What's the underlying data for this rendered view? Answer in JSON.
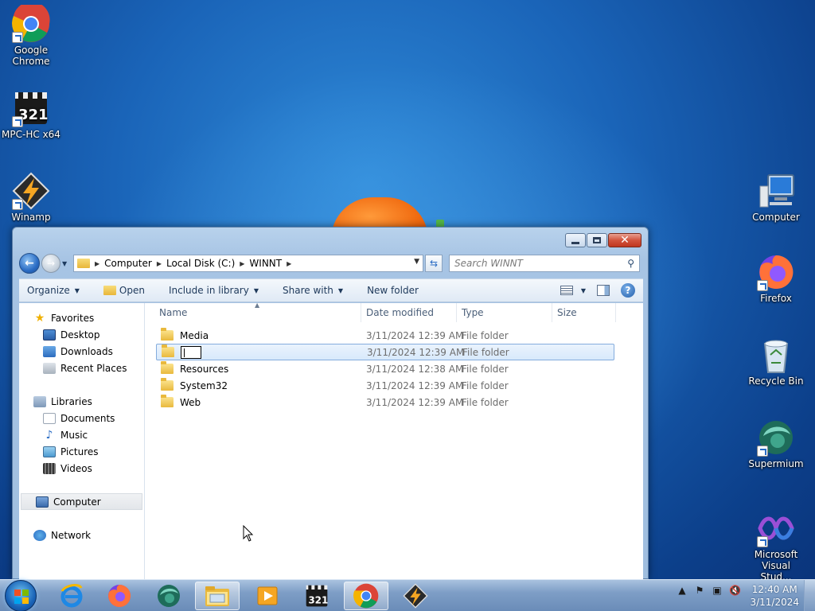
{
  "desktop": {
    "icons_left": [
      {
        "label_line1": "Google",
        "label_line2": "Chrome",
        "icon": "chrome-icon"
      },
      {
        "label_line1": "MPC-HC x64",
        "label_line2": "",
        "icon": "mpc-hc-icon"
      },
      {
        "label_line1": "Winamp",
        "label_line2": "",
        "icon": "winamp-icon"
      }
    ],
    "icons_right": [
      {
        "label_line1": "Computer",
        "label_line2": "",
        "icon": "computer-icon"
      },
      {
        "label_line1": "Firefox",
        "label_line2": "",
        "icon": "firefox-icon"
      },
      {
        "label_line1": "Recycle Bin",
        "label_line2": "",
        "icon": "recycle-bin-icon"
      },
      {
        "label_line1": "Supermium",
        "label_line2": "",
        "icon": "supermium-icon"
      },
      {
        "label_line1": "Microsoft",
        "label_line2": "Visual Stud...",
        "icon": "visual-studio-icon"
      }
    ]
  },
  "explorer": {
    "breadcrumbs": [
      "Computer",
      "Local Disk (C:)",
      "WINNT"
    ],
    "search_placeholder": "Search WINNT",
    "toolbar": {
      "organize": "Organize",
      "open": "Open",
      "include_in_library": "Include in library",
      "share_with": "Share with",
      "new_folder": "New folder"
    },
    "nav_pane": {
      "favorites": "Favorites",
      "favorites_items": [
        "Desktop",
        "Downloads",
        "Recent Places"
      ],
      "libraries": "Libraries",
      "libraries_items": [
        "Documents",
        "Music",
        "Pictures",
        "Videos"
      ],
      "computer": "Computer",
      "network": "Network"
    },
    "columns": [
      "Name",
      "Date modified",
      "Type",
      "Size"
    ],
    "rows": [
      {
        "name": "Media",
        "date": "3/11/2024 12:39 AM",
        "type": "File folder",
        "renaming": false
      },
      {
        "name": "",
        "date": "3/11/2024 12:39 AM",
        "type": "File folder",
        "renaming": true
      },
      {
        "name": "Resources",
        "date": "3/11/2024 12:38 AM",
        "type": "File folder",
        "renaming": false
      },
      {
        "name": "System32",
        "date": "3/11/2024 12:39 AM",
        "type": "File folder",
        "renaming": false
      },
      {
        "name": "Web",
        "date": "3/11/2024 12:39 AM",
        "type": "File folder",
        "renaming": false
      }
    ]
  },
  "taskbar": {
    "clock_time": "12:40 AM",
    "clock_date": "3/11/2024",
    "apps": [
      "internet-explorer-icon",
      "firefox-icon",
      "supermium-icon",
      "file-explorer-icon",
      "media-player-icon",
      "mpc-hc-icon",
      "chrome-icon",
      "winamp-icon"
    ]
  }
}
